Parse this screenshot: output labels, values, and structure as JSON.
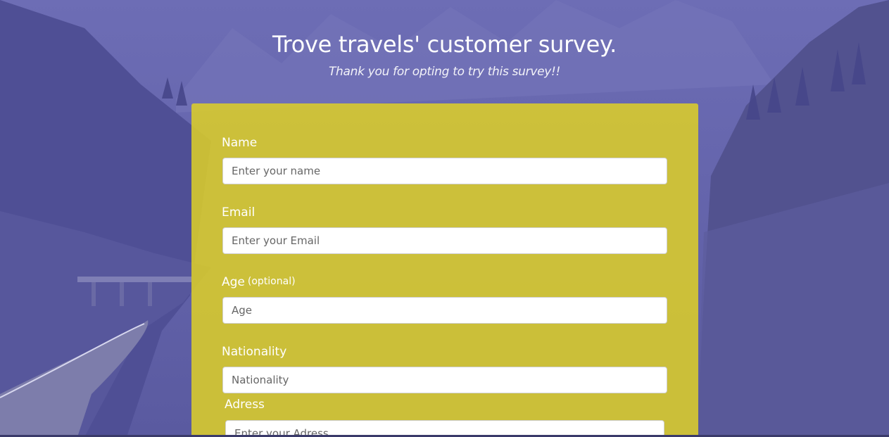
{
  "page": {
    "title": "Trove travels' customer survey.",
    "subtitle": "Thank you for opting to try this survey!!"
  },
  "colors": {
    "background_tint": "#5b5ba3",
    "form_background": "#dbcd2a",
    "label_text": "#ffffff"
  },
  "form": {
    "name": {
      "label": "Name",
      "placeholder": "Enter your name",
      "value": ""
    },
    "email": {
      "label": "Email",
      "placeholder": "Enter your Email",
      "value": ""
    },
    "age": {
      "label": "Age",
      "optional_note": "(optional)",
      "placeholder": "Age",
      "value": ""
    },
    "nationality": {
      "label": "Nationality",
      "placeholder": "Nationality",
      "value": ""
    },
    "address": {
      "label": "Adress",
      "placeholder": "Enter your Adress",
      "value": ""
    }
  }
}
